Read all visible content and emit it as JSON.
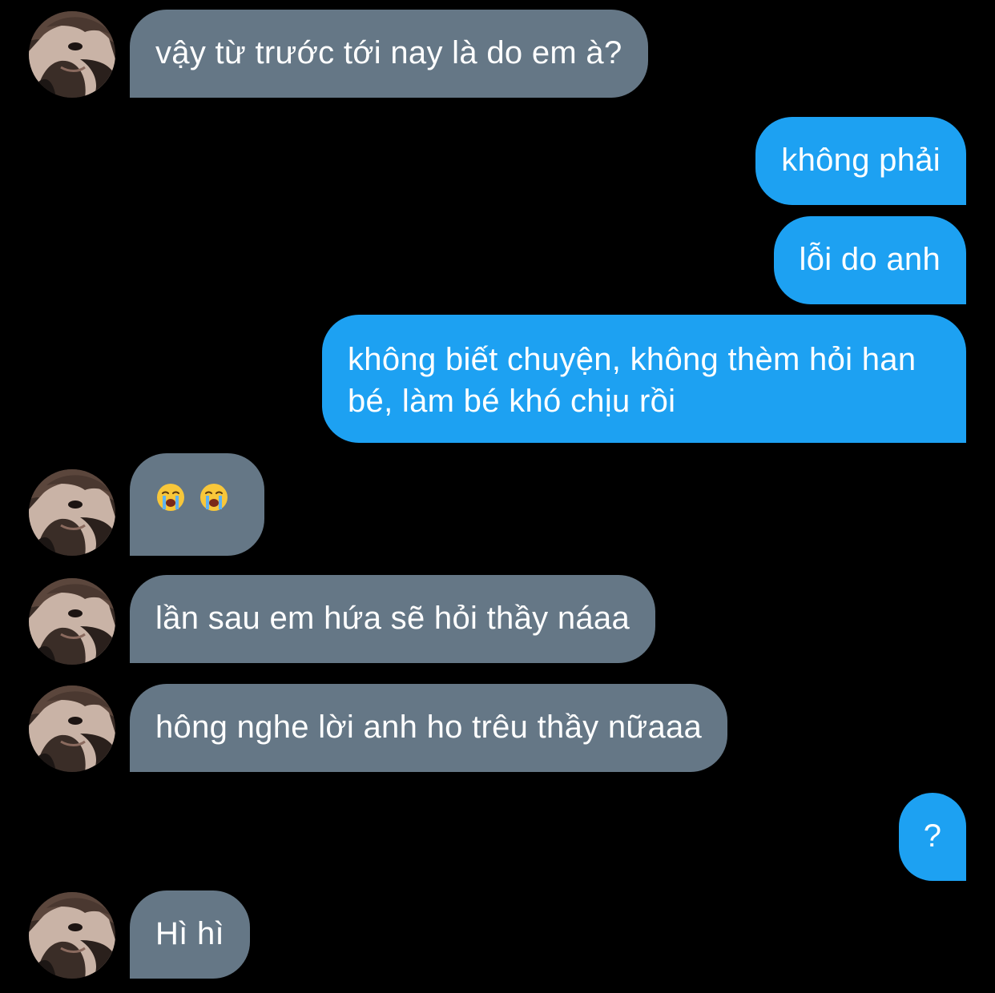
{
  "conversation": {
    "messages": [
      {
        "sender": "them",
        "text": "vậy từ trước tới nay là do em à?"
      },
      {
        "sender": "me",
        "text": "không phải"
      },
      {
        "sender": "me",
        "text": "lỗi do anh"
      },
      {
        "sender": "me",
        "text": "không biết chuyện, không thèm hỏi han bé, làm bé khó chịu rồi"
      },
      {
        "sender": "them",
        "text": "",
        "emojis": [
          "loudly-crying-face-icon",
          "loudly-crying-face-icon"
        ]
      },
      {
        "sender": "them",
        "text": "lần sau em hứa sẽ hỏi thầy náaa"
      },
      {
        "sender": "them",
        "text": "hông nghe lời anh ho trêu thầy nữaaa"
      },
      {
        "sender": "me",
        "text": "?"
      },
      {
        "sender": "them",
        "text": "Hì hì"
      }
    ]
  },
  "colors": {
    "background": "#000000",
    "incoming_bubble": "#657786",
    "outgoing_bubble": "#1da1f2",
    "text": "#ffffff"
  }
}
